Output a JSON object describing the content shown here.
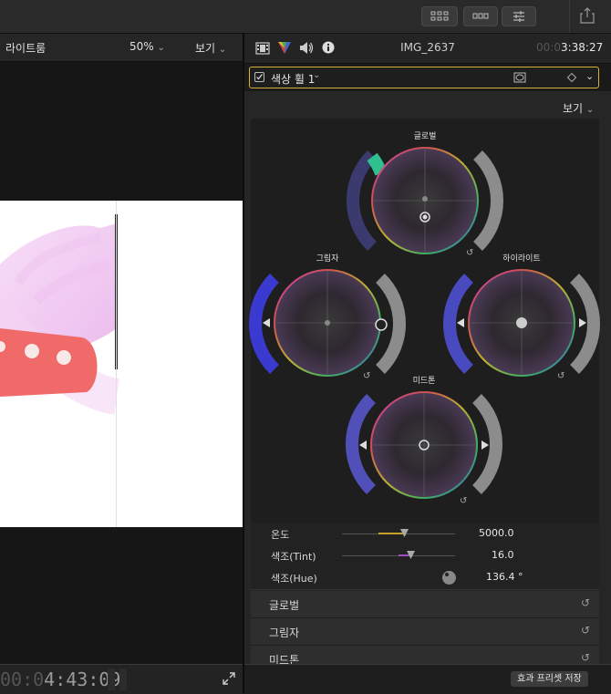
{
  "viewer": {
    "title": "라이트룸",
    "zoom": "50%",
    "view_label": "보기",
    "timecode_lead": "00:0",
    "timecode": "4:43:09"
  },
  "inspector": {
    "clip_name": "IMG_2637",
    "duration_lead": "00:0",
    "duration": "3:38:27",
    "effect_name": "색상 휠 1",
    "view_label": "보기",
    "wheels": {
      "global": "글로벌",
      "shadows": "그림자",
      "highlights": "하이라이트",
      "midtones": "미드톤"
    },
    "sliders": [
      {
        "label": "온도",
        "value": "5000.0"
      },
      {
        "label": "색조(Tint)",
        "value": "16.0"
      },
      {
        "label": "색조(Hue)",
        "value": "136.4 °"
      }
    ],
    "sections": [
      "글로벌",
      "그림자",
      "미드톤"
    ],
    "save_button": "효과 프리셋 저장"
  },
  "icons": {
    "grid": "grid-icon",
    "filmstrip": "filmstrip-icon",
    "sliders": "sliders-icon",
    "share": "share-icon",
    "video": "video-inspector-icon",
    "color": "color-inspector-icon",
    "audio": "audio-inspector-icon",
    "info": "info-inspector-icon",
    "reset": "reset-icon",
    "fullscreen": "fullscreen-icon"
  },
  "colors": {
    "accent": "#d6b234",
    "panel": "#262626",
    "temp_thumb": "#c8a02a",
    "tint_thumb": "#a04cc0"
  }
}
